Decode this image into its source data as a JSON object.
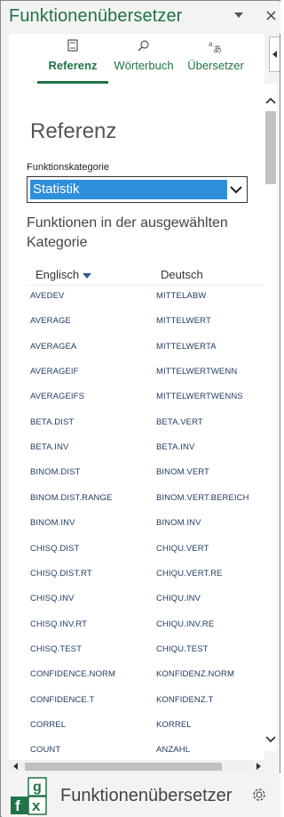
{
  "app": {
    "title": "Funktionenübersetzer",
    "footer_title": "Funktionenübersetzer",
    "accent_color": "#217346"
  },
  "titlebar": {
    "dropdown_icon": "chevron-down-icon",
    "close_icon": "close-icon"
  },
  "tabs": [
    {
      "label": "Referenz",
      "icon": "book-icon",
      "active": true
    },
    {
      "label": "Wörterbuch",
      "icon": "search-icon",
      "active": false
    },
    {
      "label": "Übersetzer",
      "icon": "translate-icon",
      "active": false
    }
  ],
  "main": {
    "heading": "Referenz",
    "category_label": "Funktionskategorie",
    "category_selected": "Statistik",
    "list_heading": "Funktionen in der ausgewählten Kategorie",
    "col_english": "Englisch",
    "col_german": "Deutsch"
  },
  "functions": [
    {
      "en": "AVEDEV",
      "de": "MITTELABW"
    },
    {
      "en": "AVERAGE",
      "de": "MITTELWERT"
    },
    {
      "en": "AVERAGEA",
      "de": "MITTELWERTA"
    },
    {
      "en": "AVERAGEIF",
      "de": "MITTELWERTWENN"
    },
    {
      "en": "AVERAGEIFS",
      "de": "MITTELWERTWENNS"
    },
    {
      "en": "BETA.DIST",
      "de": "BETA.VERT"
    },
    {
      "en": "BETA.INV",
      "de": "BETA.INV"
    },
    {
      "en": "BINOM.DIST",
      "de": "BINOM.VERT"
    },
    {
      "en": "BINOM.DIST.RANGE",
      "de": "BINOM.VERT.BEREICH"
    },
    {
      "en": "BINOM.INV",
      "de": "BINOM.INV"
    },
    {
      "en": "CHISQ.DIST",
      "de": "CHIQU.VERT"
    },
    {
      "en": "CHISQ.DIST.RT",
      "de": "CHIQU.VERT.RE"
    },
    {
      "en": "CHISQ.INV",
      "de": "CHIQU.INV"
    },
    {
      "en": "CHISQ.INV.RT",
      "de": "CHIQU.INV.RE"
    },
    {
      "en": "CHISQ.TEST",
      "de": "CHIQU.TEST"
    },
    {
      "en": "CONFIDENCE.NORM",
      "de": "KONFIDENZ.NORM"
    },
    {
      "en": "CONFIDENCE.T",
      "de": "KONFIDENZ.T"
    },
    {
      "en": "CORREL",
      "de": "KORREL"
    },
    {
      "en": "COUNT",
      "de": "ANZAHL"
    }
  ],
  "logo": {
    "letters": [
      "g",
      "f",
      "x"
    ]
  }
}
